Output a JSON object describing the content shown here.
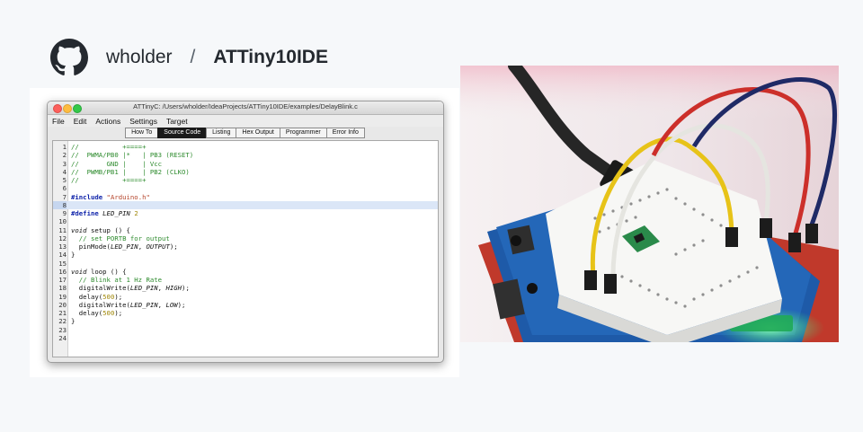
{
  "header": {
    "logo_icon": "github-octocat-icon",
    "owner": "wholder",
    "separator": "/",
    "repo": "ATTiny10IDE"
  },
  "window": {
    "title": "ATTinyC: /Users/wholder/IdeaProjects/ATTiny10IDE/examples/DelayBlink.c",
    "menu": [
      "File",
      "Edit",
      "Actions",
      "Settings",
      "Target"
    ],
    "tabs": [
      {
        "label": "How To",
        "active": false
      },
      {
        "label": "Source Code",
        "active": true
      },
      {
        "label": "Listing",
        "active": false
      },
      {
        "label": "Hex Output",
        "active": false
      },
      {
        "label": "Programmer",
        "active": false
      },
      {
        "label": "Error Info",
        "active": false
      }
    ],
    "current_line": 8,
    "code_lines": [
      [
        {
          "t": "//           +====+",
          "c": "comment"
        }
      ],
      [
        {
          "t": "//  PWMA/PB0 |*   | PB3 (RESET)",
          "c": "comment"
        }
      ],
      [
        {
          "t": "//       GND |    | Vcc",
          "c": "comment"
        }
      ],
      [
        {
          "t": "//  PWMB/PB1 |    | PB2 (CLKO)",
          "c": "comment"
        }
      ],
      [
        {
          "t": "//           +====+",
          "c": "comment"
        }
      ],
      [],
      [
        {
          "t": "#include ",
          "c": "pre"
        },
        {
          "t": "\"Arduino.h\"",
          "c": "str"
        }
      ],
      [],
      [
        {
          "t": "#define ",
          "c": "pre"
        },
        {
          "t": "LED_PIN",
          "c": "const"
        },
        {
          "t": " "
        },
        {
          "t": "2",
          "c": "num"
        }
      ],
      [],
      [
        {
          "t": "void",
          "c": "kw"
        },
        {
          "t": " setup () {"
        }
      ],
      [
        {
          "t": "  // set PORTB for output",
          "c": "comment"
        }
      ],
      [
        {
          "t": "  pinMode("
        },
        {
          "t": "LED_PIN",
          "c": "const"
        },
        {
          "t": ", "
        },
        {
          "t": "OUTPUT",
          "c": "const"
        },
        {
          "t": ");"
        }
      ],
      [
        {
          "t": "}"
        }
      ],
      [],
      [
        {
          "t": "void",
          "c": "kw"
        },
        {
          "t": " loop () {"
        }
      ],
      [
        {
          "t": "  // Blink at 1 Hz Rate",
          "c": "comment"
        }
      ],
      [
        {
          "t": "  digitalWrite("
        },
        {
          "t": "LED_PIN",
          "c": "const"
        },
        {
          "t": ", "
        },
        {
          "t": "HIGH",
          "c": "const"
        },
        {
          "t": ");"
        }
      ],
      [
        {
          "t": "  delay("
        },
        {
          "t": "500",
          "c": "num"
        },
        {
          "t": ");"
        }
      ],
      [
        {
          "t": "  digitalWrite("
        },
        {
          "t": "LED_PIN",
          "c": "const"
        },
        {
          "t": ", "
        },
        {
          "t": "LOW",
          "c": "const"
        },
        {
          "t": ");"
        }
      ],
      [
        {
          "t": "  delay("
        },
        {
          "t": "500",
          "c": "num"
        },
        {
          "t": ");"
        }
      ],
      [
        {
          "t": "}"
        }
      ],
      [],
      []
    ]
  },
  "photo": {
    "subject": "breadboard-with-attiny10-and-jumper-wires",
    "wire_colors": [
      "#2b2b2b",
      "#e7c318",
      "#e5e5e0",
      "#cc2f2a",
      "#1f2a66"
    ],
    "board_color": "#1e5aa8",
    "led_color": "#33e07a"
  }
}
